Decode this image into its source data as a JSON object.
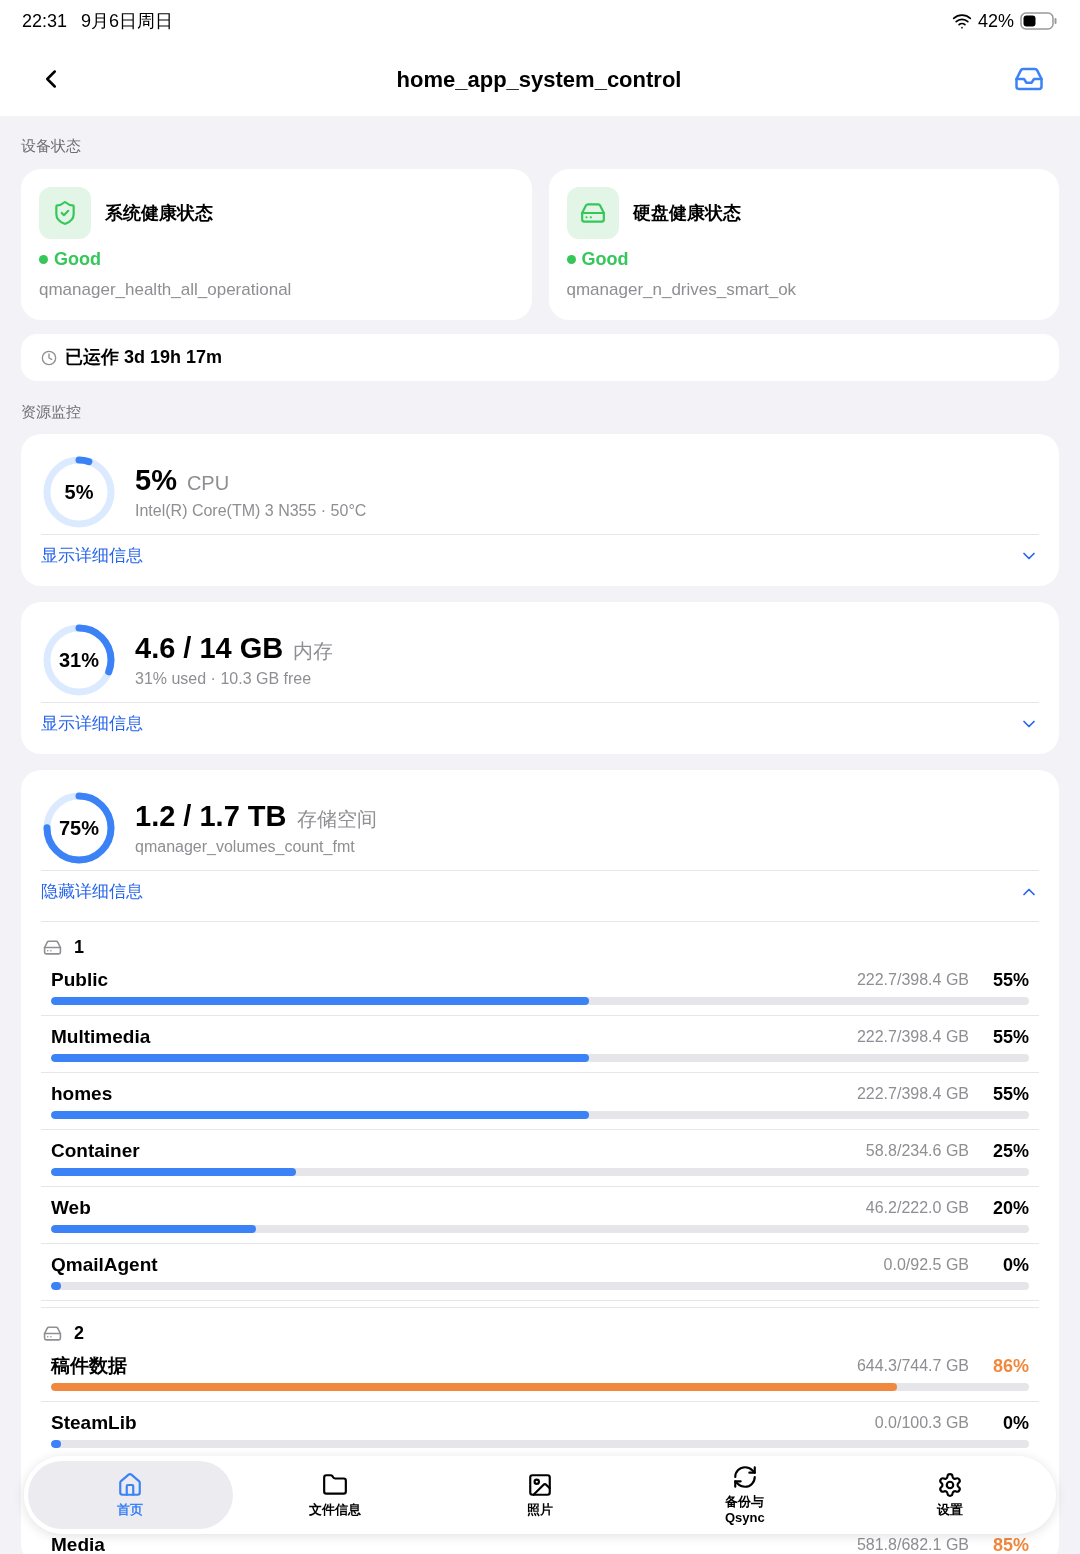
{
  "status_bar": {
    "time": "22:31",
    "date": "9月6日周日",
    "battery": "42%"
  },
  "header": {
    "title": "home_app_system_control"
  },
  "device_status": {
    "label": "设备状态",
    "cards": [
      {
        "title": "系统健康状态",
        "status": "Good",
        "detail": "qmanager_health_all_operational"
      },
      {
        "title": "硬盘健康状态",
        "status": "Good",
        "detail": "qmanager_n_drives_smart_ok"
      }
    ],
    "uptime": "已运作 3d 19h 17m"
  },
  "resources": {
    "label": "资源监控",
    "items": [
      {
        "percent": "5%",
        "level": 0.05,
        "value": "5%",
        "unit": "CPU",
        "detail": "Intel(R) Core(TM) 3 N355 · 50°C",
        "toggle": "显示详细信息",
        "expanded": false
      },
      {
        "percent": "31%",
        "level": 0.31,
        "value": "4.6 / 14 GB",
        "unit": "内存",
        "detail": "31% used · 10.3 GB free",
        "toggle": "显示详细信息",
        "expanded": false
      },
      {
        "percent": "75%",
        "level": 0.75,
        "value": "1.2 / 1.7 TB",
        "unit": "存储空间",
        "detail": "qmanager_volumes_count_fmt",
        "toggle": "隐藏详细信息",
        "expanded": true,
        "groups": [
          {
            "name": "1",
            "volumes": [
              {
                "name": "Public",
                "usage": "222.7/398.4 GB",
                "percent": "55%",
                "level": 0.55,
                "color": "#3b82f6"
              },
              {
                "name": "Multimedia",
                "usage": "222.7/398.4 GB",
                "percent": "55%",
                "level": 0.55,
                "color": "#3b82f6"
              },
              {
                "name": "homes",
                "usage": "222.7/398.4 GB",
                "percent": "55%",
                "level": 0.55,
                "color": "#3b82f6"
              },
              {
                "name": "Container",
                "usage": "58.8/234.6 GB",
                "percent": "25%",
                "level": 0.25,
                "color": "#3b82f6"
              },
              {
                "name": "Web",
                "usage": "46.2/222.0 GB",
                "percent": "20%",
                "level": 0.21,
                "color": "#3b82f6"
              },
              {
                "name": "QmailAgent",
                "usage": "0.0/92.5 GB",
                "percent": "0%",
                "level": 0,
                "color": "#3b82f6"
              }
            ]
          },
          {
            "name": "2",
            "volumes": [
              {
                "name": "稿件数据",
                "usage": "644.3/744.7 GB",
                "percent": "86%",
                "level": 0.865,
                "color": "#f0883e"
              },
              {
                "name": "SteamLib",
                "usage": "0.0/100.3 GB",
                "percent": "0%",
                "level": 0,
                "color": "#3b82f6"
              }
            ]
          }
        ],
        "hidden_volume": {
          "name": "Media",
          "usage": "581.8/682.1 GB",
          "percent": "85%",
          "color": "#f0883e"
        }
      }
    ]
  },
  "tab_bar": {
    "tabs": [
      {
        "label": "首页",
        "selected": true
      },
      {
        "label": "文件信息",
        "selected": false
      },
      {
        "label": "照片",
        "selected": false
      },
      {
        "label": "备份与\nQsync",
        "selected": false
      },
      {
        "label": "设置",
        "selected": false
      }
    ]
  }
}
